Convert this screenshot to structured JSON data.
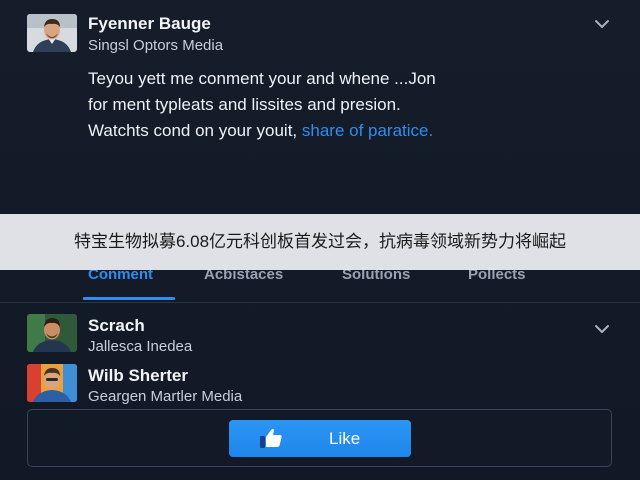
{
  "post": {
    "author": "Fyenner Bauge",
    "subtitle": "Singsl Optors Media",
    "body_line1": "Teyou yett me conment your and whene ...Jon",
    "body_line2": "for ment typleats and lissites and presion.",
    "body_line3_text": "Watchts cond on your youit, ",
    "body_line3_link": "share of paratice."
  },
  "banner": {
    "text": "特宝生物拟募6.08亿元科创板首发过会，抗病毒领域新势力将崛起"
  },
  "tabs": [
    {
      "label": "Conment"
    },
    {
      "label": "Acbistaces"
    },
    {
      "label": "Solutions"
    },
    {
      "label": "Pollects"
    }
  ],
  "comments": [
    {
      "author": "Scrach",
      "subtitle": "Jallesca Inedea"
    },
    {
      "author": "Wilb Sherter",
      "subtitle": "Geargen Martler Media"
    }
  ],
  "like_button": {
    "label": "Like"
  },
  "colors": {
    "background": "#141b28",
    "accent": "#2f8df0",
    "banner_bg": "#eceef2"
  },
  "icons": [
    "chevron-down-icon",
    "thumbs-up-icon"
  ]
}
